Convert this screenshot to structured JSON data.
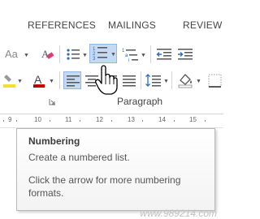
{
  "tabs": [
    "REFERENCES",
    "MAILINGS",
    "REVIEW"
  ],
  "ribbon": {
    "font_size_label": "Aa",
    "group_label": "Paragraph"
  },
  "ruler": {
    "numbers": [
      "9",
      "10",
      "11",
      "12",
      "13",
      "14",
      "15"
    ]
  },
  "tooltip": {
    "title": "Numbering",
    "line1": "Create a numbered list.",
    "line2": "Click the arrow for more numbering formats."
  },
  "watermark": "www.989214.com",
  "colors": {
    "font_color": "#c00000",
    "highlight": "#f2e030",
    "selected_bg": "#c5daf2",
    "accent_blue": "#2a6ebb"
  },
  "icons": [
    "change-case-icon",
    "clear-formatting-icon",
    "bullets-icon",
    "numbering-icon",
    "multilevel-list-icon",
    "decrease-indent-icon",
    "increase-indent-icon",
    "highlight-icon",
    "font-color-icon",
    "align-left-icon",
    "align-center-icon",
    "align-right-icon",
    "justify-icon",
    "line-spacing-icon",
    "shading-icon",
    "borders-icon",
    "hand-cursor-icon",
    "dialog-launcher-icon"
  ]
}
